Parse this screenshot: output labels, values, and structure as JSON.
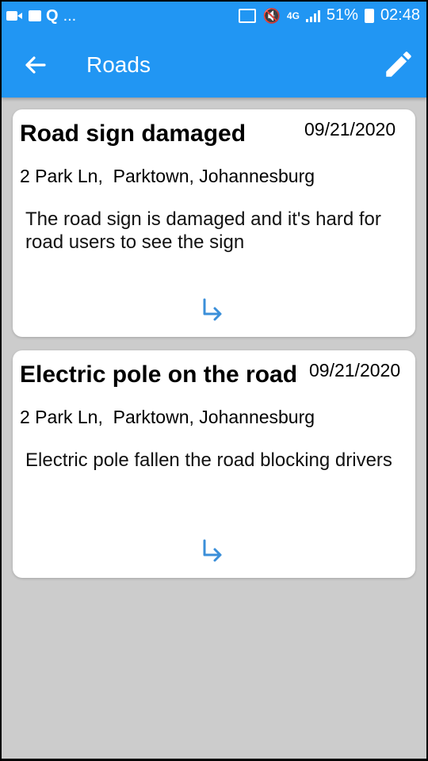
{
  "status_bar": {
    "left_icons": [
      "video-icon",
      "image-icon",
      "q-icon"
    ],
    "more": "...",
    "network": "4G",
    "battery": "51%",
    "time": "02:48"
  },
  "toolbar": {
    "title": "Roads",
    "back_icon": "arrow-left-icon",
    "edit_icon": "pencil-icon",
    "color": "#2196f3"
  },
  "reports": [
    {
      "title": "Road sign damaged",
      "date": "09/21/2020",
      "address": "2 Park Ln,  Parktown, Johannesburg",
      "description": "The road sign is damaged and it's hard for road users to see the sign"
    },
    {
      "title": "Electric pole on the road",
      "date": "09/21/2020",
      "address": "2 Park Ln,  Parktown, Johannesburg",
      "description": "Electric pole fallen the road blocking drivers"
    }
  ],
  "accent_color": "#3b8fd9",
  "background_color": "#cccccc"
}
